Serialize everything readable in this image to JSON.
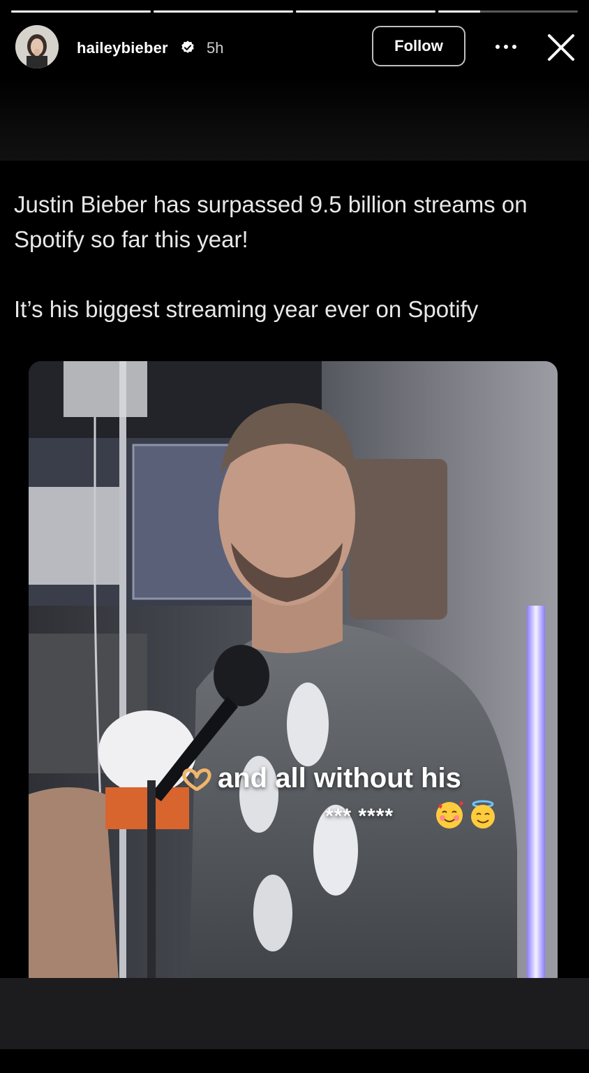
{
  "story": {
    "segments": [
      1,
      1,
      1,
      0.3
    ]
  },
  "header": {
    "username": "haileybieber",
    "verified": true,
    "time": "5h",
    "follow_label": "Follow",
    "icons": [
      "avatar",
      "verified-badge-icon",
      "more-options-icon",
      "close-icon"
    ]
  },
  "post": {
    "line1": "Justin Bieber has surpassed 9.5 billion streams on Spotify so far this year!",
    "line2": "It’s his biggest streaming year ever on Spotify"
  },
  "sticker": {
    "line1": "and all without his",
    "line2": "*** ****",
    "icons": [
      "heart-hands-icon",
      "smiling-face-with-hearts-icon",
      "smiling-face-with-halo-icon"
    ]
  },
  "colors": {
    "background": "#000000",
    "bottom_bar": "#1c1c1e",
    "text": "#e8e8e8"
  }
}
